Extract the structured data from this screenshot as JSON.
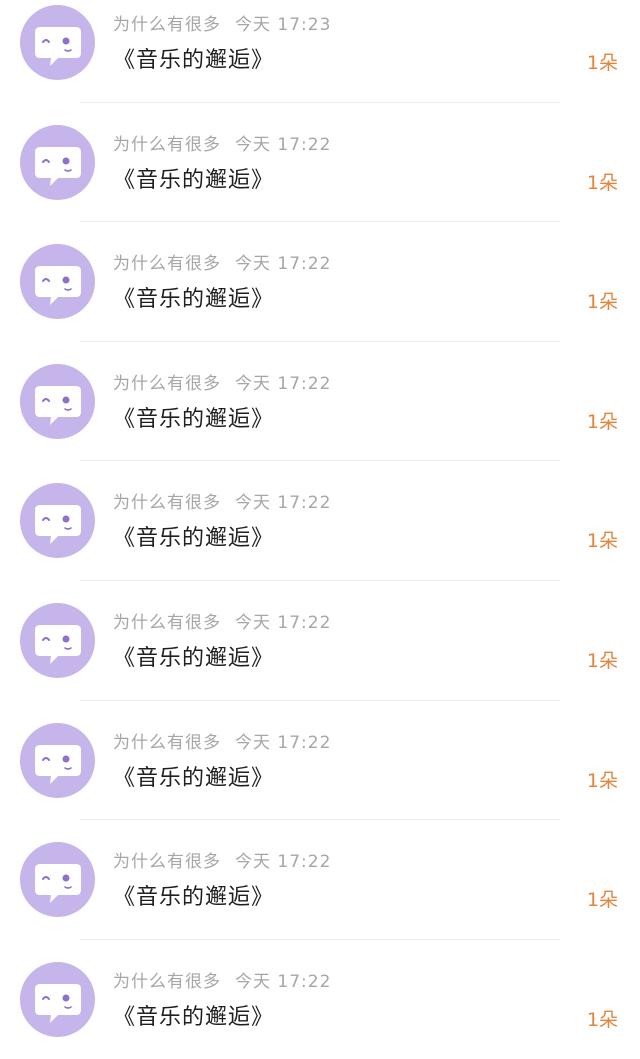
{
  "colors": {
    "avatar_bg": "#c6b5ea",
    "avatar_face": "#8f70c9",
    "username": "#a6a6a6",
    "message": "#1f1f1f",
    "count": "#e6843a"
  },
  "avatar_icon": "chat-bubble-face-icon",
  "messages": [
    {
      "user": "为什么有很多",
      "time": "今天 17:23",
      "text": "《音乐的邂逅》",
      "count": "1朵"
    },
    {
      "user": "为什么有很多",
      "time": "今天 17:22",
      "text": "《音乐的邂逅》",
      "count": "1朵"
    },
    {
      "user": "为什么有很多",
      "time": "今天 17:22",
      "text": "《音乐的邂逅》",
      "count": "1朵"
    },
    {
      "user": "为什么有很多",
      "time": "今天 17:22",
      "text": "《音乐的邂逅》",
      "count": "1朵"
    },
    {
      "user": "为什么有很多",
      "time": "今天 17:22",
      "text": "《音乐的邂逅》",
      "count": "1朵"
    },
    {
      "user": "为什么有很多",
      "time": "今天 17:22",
      "text": "《音乐的邂逅》",
      "count": "1朵"
    },
    {
      "user": "为什么有很多",
      "time": "今天 17:22",
      "text": "《音乐的邂逅》",
      "count": "1朵"
    },
    {
      "user": "为什么有很多",
      "time": "今天 17:22",
      "text": "《音乐的邂逅》",
      "count": "1朵"
    },
    {
      "user": "为什么有很多",
      "time": "今天 17:22",
      "text": "《音乐的邂逅》",
      "count": "1朵"
    }
  ]
}
